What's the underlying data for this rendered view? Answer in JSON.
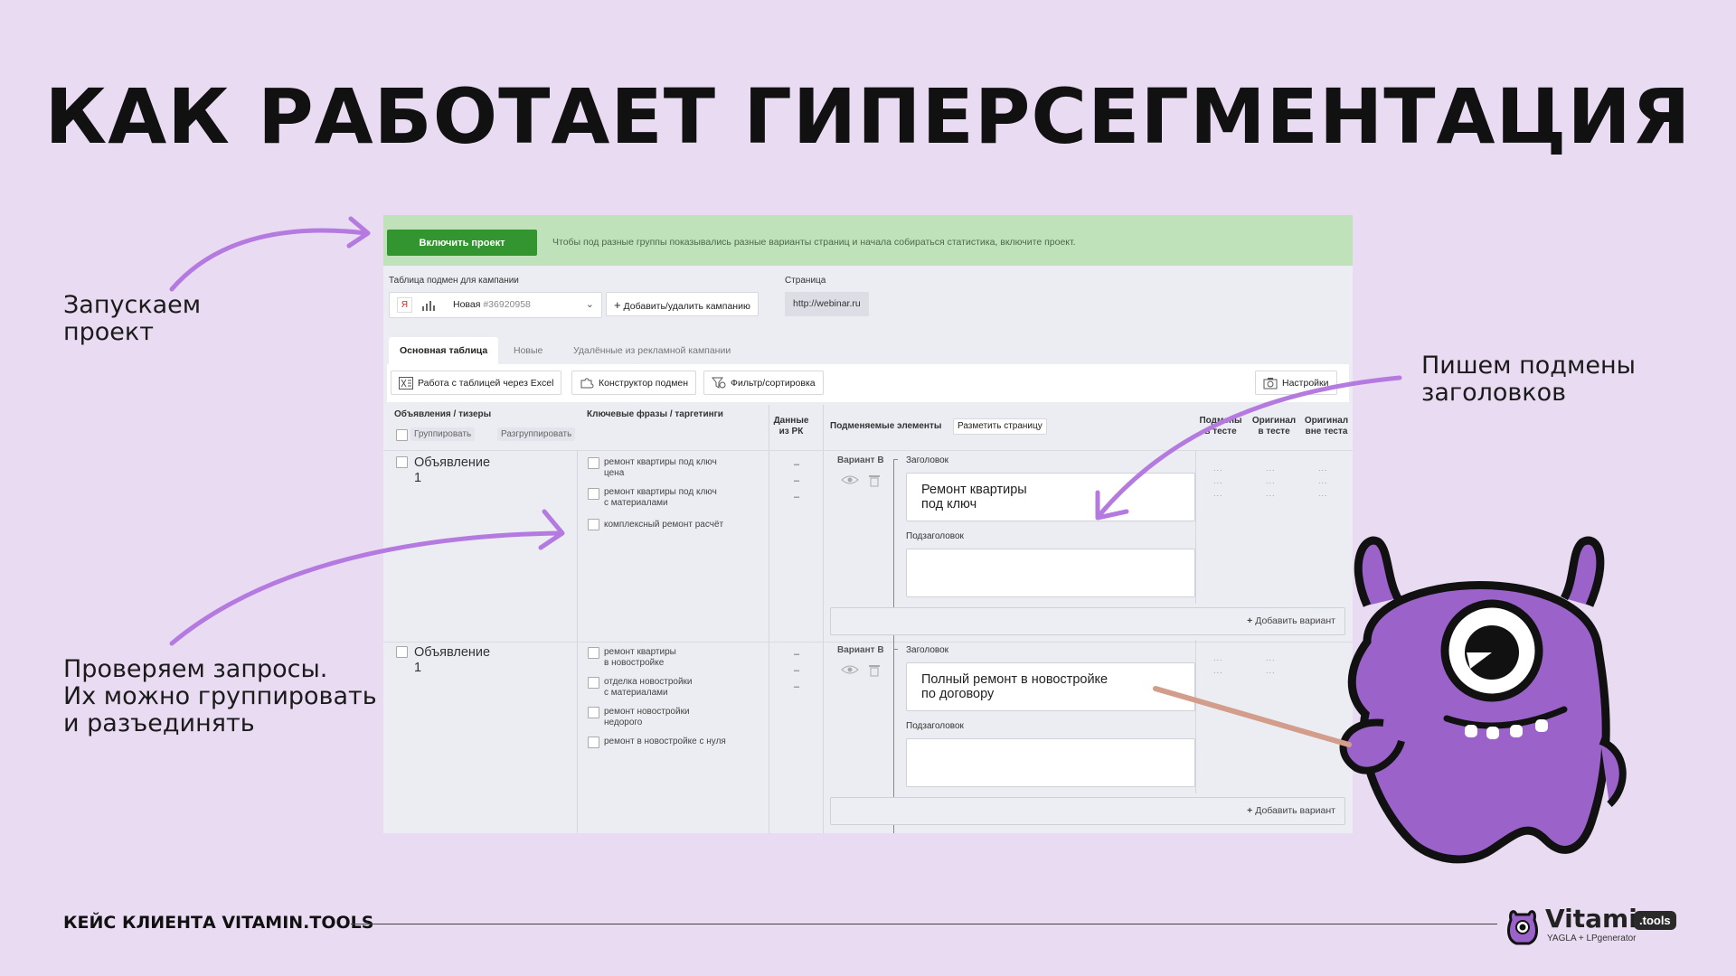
{
  "slide": {
    "title": "КАК РАБОТАЕТ ГИПЕРСЕГМЕНТАЦИЯ",
    "captions": {
      "launch": "Запускаем\nпроект",
      "headlines": "Пишем подмены\nзаголовков",
      "queries": "Проверяем запросы.\nИх можно группировать\nи разъединять"
    },
    "footer": "КЕЙС КЛИЕНТА VITAMIN.TOOLS",
    "brand": {
      "name": "Vitamin",
      "badge": ".tools",
      "tagline": "YAGLA + LPgenerator"
    },
    "colors": {
      "background": "#e9dcf2",
      "arrow": "#b57ae0",
      "mascot": "#9b62c9",
      "green_button": "#33952f"
    }
  },
  "app": {
    "enable_button": "Включить проект",
    "enable_message": "Чтобы под разные группы показывались разные варианты страниц и начала собираться статистика, включите проект.",
    "campaign_label": "Таблица подмен для кампании",
    "campaign_select": {
      "ya_icon": "Я",
      "name": "Новая",
      "number": "#36920958"
    },
    "add_remove_campaign": "Добавить/удалить кампанию",
    "page_label": "Страница",
    "page_url": "http://webinar.ru",
    "tabs": [
      "Основная таблица",
      "Новые",
      "Удалённые из рекламной кампании"
    ],
    "toolbar": {
      "excel": "Работа с таблицей через Excel",
      "constructor": "Конструктор подмен",
      "filter": "Фильтр/сортировка",
      "settings": "Настройки"
    },
    "columns": {
      "ads": "Объявления / тизеры",
      "keywords": "Ключевые фразы / таргетинги",
      "rk_data": "Данные\nиз РК",
      "elements": "Подменяемые элементы",
      "mark_page": "Разметить страницу",
      "in_test": "Подмены\nв тесте",
      "orig_in_test": "Оригинал\nв тесте",
      "orig_out_test": "Оригинал\nвне теста"
    },
    "group_btn": "Группировать",
    "ungroup_btn": "Разгруппировать",
    "rows": [
      {
        "ad": "Объявление\n1",
        "phrases": [
          "ремонт квартиры под ключ\nцена",
          "ремонт квартиры под ключ\nс материалами",
          "комплексный ремонт расчёт"
        ],
        "variant": "Вариант В",
        "headline_label": "Заголовок",
        "headline": "Ремонт квартиры\nпод ключ",
        "subheadline_label": "Подзаголовок",
        "subheadline": "",
        "add_variant": "Добавить вариант"
      },
      {
        "ad": "Объявление\n1",
        "phrases": [
          "ремонт квартиры\nв новостройке",
          "отделка новостройки\nс материалами",
          "ремонт новостройки\nнедорого",
          "ремонт в новостройке с нуля"
        ],
        "variant": "Вариант В",
        "headline_label": "Заголовок",
        "headline": "Полный ремонт в новостройке\nпо договору",
        "subheadline_label": "Подзаголовок",
        "subheadline": "",
        "add_variant": "Добавить вариант"
      }
    ],
    "dash": "–",
    "dots": "..."
  }
}
